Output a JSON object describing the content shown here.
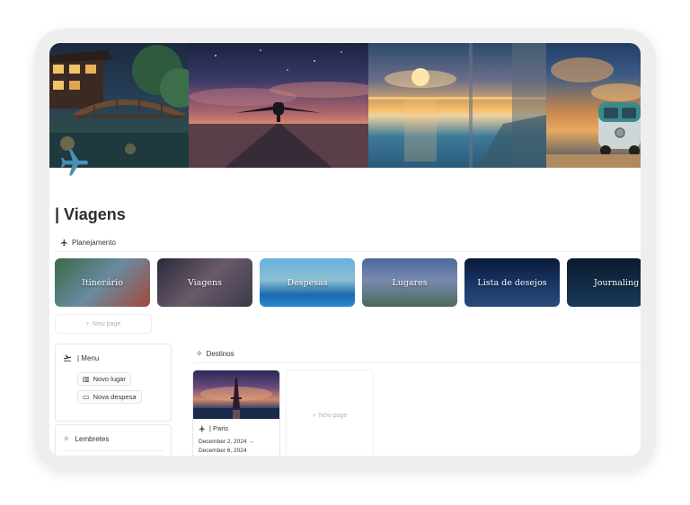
{
  "page": {
    "title": "| Viagens",
    "icon": "airplane-icon",
    "accent": "#4a8fb6"
  },
  "cover": {
    "panels": [
      "garden-bridge",
      "airplane-sunset",
      "ocean-sunset",
      "van-beach"
    ]
  },
  "planning": {
    "heading": "Planejamento",
    "icon": "airplane-icon",
    "cards": [
      {
        "label": "Itinerário"
      },
      {
        "label": "Viagens"
      },
      {
        "label": "Despesas"
      },
      {
        "label": "Lugares"
      },
      {
        "label": "Lista de desejos"
      },
      {
        "label": "Journaling"
      }
    ],
    "new_page_label": "New page"
  },
  "menu": {
    "title": "| Menu",
    "icon": "airplane-icon",
    "buttons": [
      {
        "label": "Novo lugar",
        "icon": "map-icon"
      },
      {
        "label": "Nova despesa",
        "icon": "money-icon"
      }
    ]
  },
  "reminders": {
    "title": "Lembretes",
    "icon": "sparkle-icon"
  },
  "destinations": {
    "heading": "Destinos",
    "icon": "sparkle-icon",
    "cards": [
      {
        "title": "| Paris",
        "date_start": "December 2, 2024 →",
        "date_end": "December 6, 2024"
      }
    ],
    "new_page_label": "New page"
  }
}
